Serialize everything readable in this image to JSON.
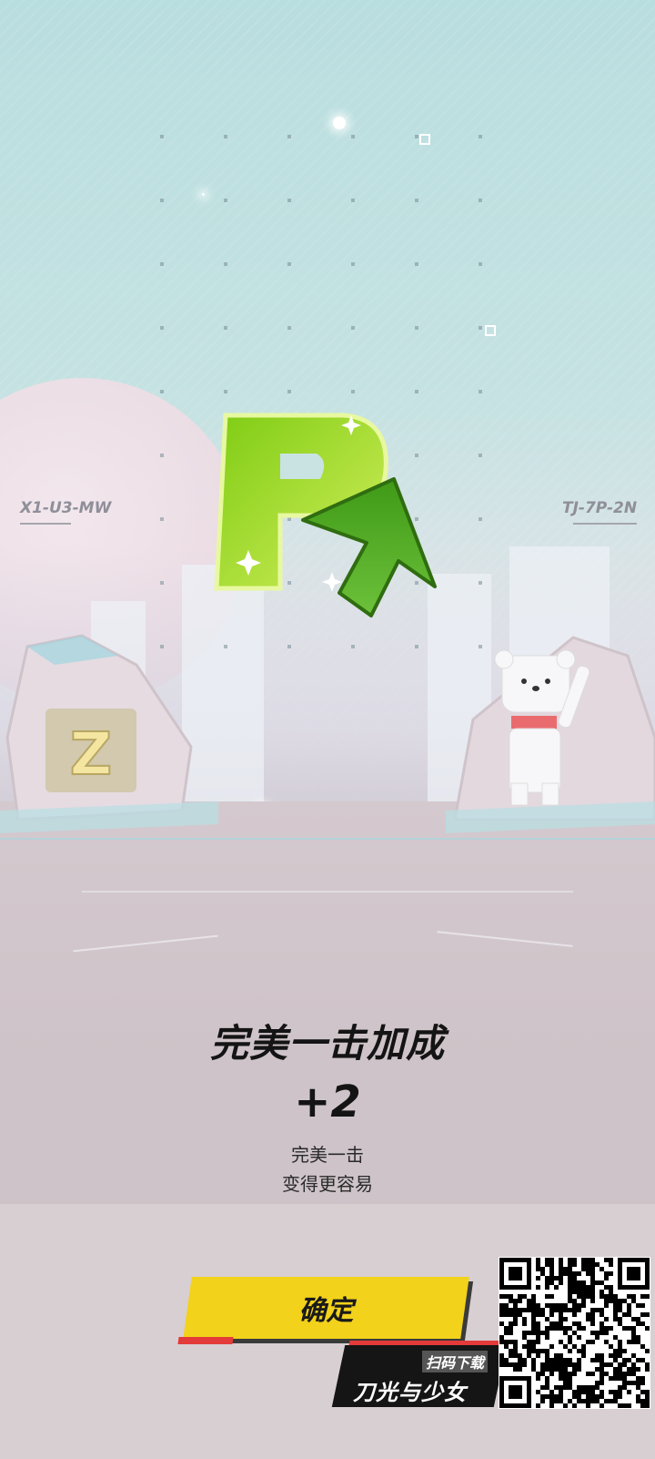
{
  "scene": {
    "left_label": "X1-U3-MW",
    "right_label": "TJ-7P-2N"
  },
  "reward": {
    "icon": "p-letter-with-up-arrow-icon",
    "title": "完美一击加成",
    "bonus": "+2",
    "description_line1": "完美一击",
    "description_line2": "变得更容易"
  },
  "confirm_button": {
    "label": "确定"
  },
  "promo": {
    "scan_label": "扫码下载",
    "game_name": "刀光与少女"
  },
  "colors": {
    "accent_yellow": "#f2d21a",
    "accent_red": "#e33a3a",
    "p_green": "#8ad11c",
    "arrow_green": "#4fa51e"
  }
}
